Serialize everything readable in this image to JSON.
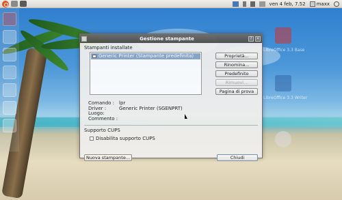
{
  "top_panel": {
    "clock": "ven  4 feb, 7.52",
    "user": "maxx"
  },
  "desktop": {
    "icon_labels": [
      "LibreOffice 3.3 Base",
      "LibreOffice 3.3 Writer"
    ]
  },
  "window": {
    "title": "Gestione stampante",
    "installed_section": "Stampanti installate",
    "printers": [
      {
        "name": "Generic Printer (Stampante predefinita)",
        "selected": true
      }
    ],
    "buttons": {
      "properties": "Proprietà...",
      "rename": "Rinomina...",
      "default": "Predefinito",
      "remove": "Rimuovi...",
      "test_page": "Pagina di prova"
    },
    "info": {
      "command_label": "Comando :",
      "command_value": "lpr",
      "driver_label": "Driver :",
      "driver_value": "Generic Printer (SGENPRT)",
      "location_label": "Luogo:",
      "location_value": "",
      "comment_label": "Commento :",
      "comment_value": ""
    },
    "cups_section": "Supporto CUPS",
    "cups_checkbox": "Disabilita supporto CUPS",
    "cups_checked": false,
    "new_printer_button": "Nuova stampante...",
    "close_button": "Chiudi"
  }
}
